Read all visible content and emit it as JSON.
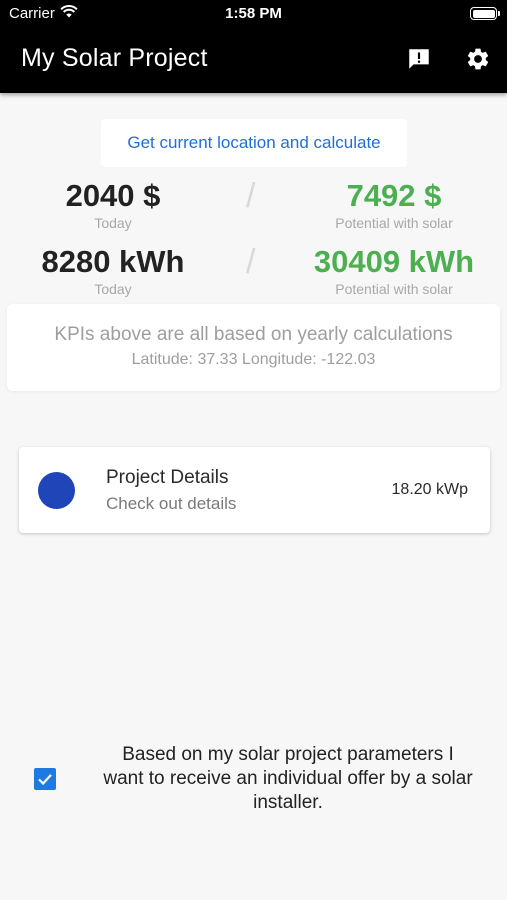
{
  "status_bar": {
    "carrier": "Carrier",
    "time": "1:58 PM",
    "battery_level": 1.0
  },
  "app_bar": {
    "title": "My Solar Project",
    "actions": [
      {
        "icon": "feedback-icon"
      },
      {
        "icon": "gear-icon"
      }
    ]
  },
  "location_button": {
    "label": "Get current location and calculate"
  },
  "kpis": {
    "cost_today": {
      "value": "2040 $",
      "label": "Today"
    },
    "cost_potential": {
      "value": "7492 $",
      "label": "Potential with solar"
    },
    "energy_today": {
      "value": "8280 kWh",
      "label": "Today"
    },
    "energy_potential": {
      "value": "30409 kWh",
      "label": "Potential with solar"
    },
    "separator": "/"
  },
  "info_card": {
    "note": "KPIs above are all based on yearly calculations",
    "coordinates": "Latitude: 37.33 Longitude: -122.03"
  },
  "project_card": {
    "title": "Project Details",
    "subtitle": "Check out details",
    "capacity": "18.20 kWp",
    "dot_color": "#1f45b8"
  },
  "offer": {
    "checked": true,
    "text": "Based on my solar project parameters I want to receive an individual offer by a solar installer."
  },
  "colors": {
    "accent": "#1e6fd9",
    "positive": "#4caf50",
    "appbar": "#000000"
  }
}
